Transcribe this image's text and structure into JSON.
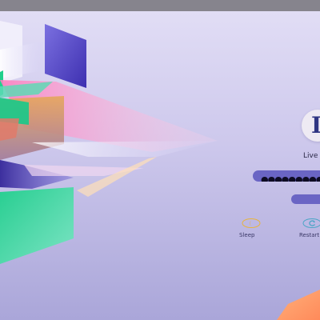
{
  "lock_screen": {
    "avatar_initial": "D",
    "username": "Live",
    "password_masked": "●●●●●●●●●●●",
    "power_actions": [
      {
        "label": "Sleep",
        "icon": "sleep-icon"
      },
      {
        "label": "Restart",
        "icon": "restart-icon"
      }
    ]
  },
  "colors": {
    "background_top": "#e3dff6",
    "background_bottom": "#aaa6d9",
    "top_bar": "#86848d",
    "accent": "#6a65c4",
    "sleep_icon": "#e8b43c",
    "restart_icon": "#4aa5c6"
  }
}
